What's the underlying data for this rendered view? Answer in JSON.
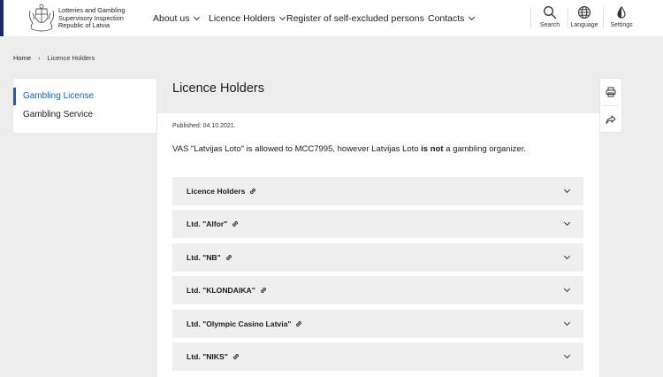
{
  "header": {
    "org_line1": "Lotteries and Gambling",
    "org_line2": "Supervisory Inspection",
    "org_line3": "Republic of Latvia",
    "nav": [
      {
        "label": "About us",
        "dropdown": true
      },
      {
        "label": "Licence Holders",
        "dropdown": true
      },
      {
        "label": "Register of self-excluded persons",
        "dropdown": false
      },
      {
        "label": "Contacts",
        "dropdown": true
      }
    ],
    "tools": [
      {
        "label": "Search",
        "icon": "search-icon"
      },
      {
        "label": "Language",
        "icon": "globe-icon"
      },
      {
        "label": "Settings",
        "icon": "contrast-drop-icon"
      }
    ]
  },
  "breadcrumb": {
    "home": "Home",
    "separator": "›",
    "current": "Licence Holders"
  },
  "sidebar": {
    "items": [
      {
        "label": "Gambling License",
        "active": true
      },
      {
        "label": "Gambling Service",
        "active": false
      }
    ]
  },
  "main": {
    "title": "Licence Holders",
    "published": "Published: 04.10.2021.",
    "intro_part1": "VAS \"Latvijas Loto\" is allowed to MCC7995, however Latvijas Loto ",
    "intro_bold": "is not",
    "intro_part2": " a gambling organizer.",
    "accordions": [
      {
        "label": "Licence Holders"
      },
      {
        "label": "Ltd. \"Alfor\""
      },
      {
        "label": "Ltd. \"NB\""
      },
      {
        "label": "Ltd. \"KLONDAIKA\""
      },
      {
        "label": "Ltd. \"Olympic Casino Latvia\""
      },
      {
        "label": "Ltd. \"NIKS\""
      }
    ]
  },
  "float_tools": [
    {
      "icon": "print-icon"
    },
    {
      "icon": "share-icon"
    }
  ],
  "colors": {
    "accent": "#1f5bb8",
    "brand_bar": "#1c2a63",
    "background": "#ededed",
    "accordion_bg": "#efefef"
  }
}
